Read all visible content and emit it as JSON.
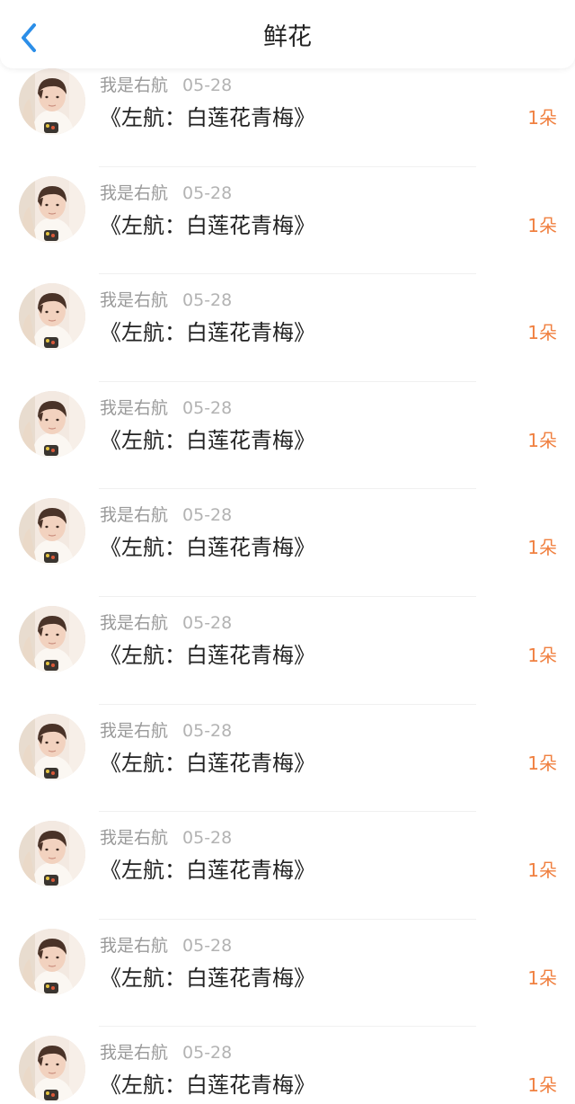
{
  "header": {
    "title": "鲜花",
    "back_icon": "chevron-left-icon",
    "accent_color": "#2b8ee8"
  },
  "colors": {
    "count": "#f08040"
  },
  "list": [
    {
      "user": "我是右航",
      "date": "05-28",
      "work": "《左航：白莲花青梅》",
      "count": "1朵"
    },
    {
      "user": "我是右航",
      "date": "05-28",
      "work": "《左航：白莲花青梅》",
      "count": "1朵"
    },
    {
      "user": "我是右航",
      "date": "05-28",
      "work": "《左航：白莲花青梅》",
      "count": "1朵"
    },
    {
      "user": "我是右航",
      "date": "05-28",
      "work": "《左航：白莲花青梅》",
      "count": "1朵"
    },
    {
      "user": "我是右航",
      "date": "05-28",
      "work": "《左航：白莲花青梅》",
      "count": "1朵"
    },
    {
      "user": "我是右航",
      "date": "05-28",
      "work": "《左航：白莲花青梅》",
      "count": "1朵"
    },
    {
      "user": "我是右航",
      "date": "05-28",
      "work": "《左航：白莲花青梅》",
      "count": "1朵"
    },
    {
      "user": "我是右航",
      "date": "05-28",
      "work": "《左航：白莲花青梅》",
      "count": "1朵"
    },
    {
      "user": "我是右航",
      "date": "05-28",
      "work": "《左航：白莲花青梅》",
      "count": "1朵"
    },
    {
      "user": "我是右航",
      "date": "05-28",
      "work": "《左航：白莲花青梅》",
      "count": "1朵"
    }
  ]
}
